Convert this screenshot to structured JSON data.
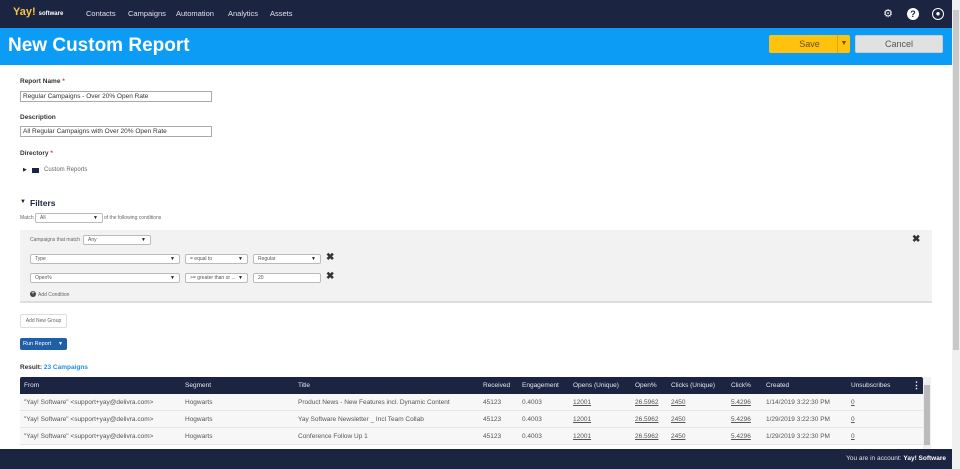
{
  "nav": {
    "logo": "Yay!",
    "logo_sub": "software",
    "items": [
      "Contacts",
      "Campaigns",
      "Automation",
      "Analytics",
      "Assets"
    ]
  },
  "header": {
    "title": "New Custom Report",
    "save": "Save",
    "cancel": "Cancel"
  },
  "form": {
    "report_name_label": "Report Name",
    "report_name": "Regular Campaigns - Over 20% Open Rate",
    "description_label": "Description",
    "description": "All Regular Campaigns with Over 20% Open Rate",
    "directory_label": "Directory",
    "directory": "Custom Reports",
    "required": "*"
  },
  "filters": {
    "title": "Filters",
    "match_label": "Match",
    "match_value": "All",
    "match_suffix": "of the following conditions",
    "group_label": "Campaigns that match",
    "group_value": "Any",
    "conditions": [
      {
        "field": "Type",
        "op": "= equal to",
        "value": "Regular"
      },
      {
        "field": "Open%",
        "op": ">= greater than or ...",
        "value": "20"
      }
    ],
    "add_condition": "Add Condition",
    "add_group": "Add New Group",
    "run": "Run Report"
  },
  "result": {
    "label": "Result:",
    "count": "23 Campaigns"
  },
  "table": {
    "columns": [
      "From",
      "Segment",
      "Title",
      "Received",
      "Engagement",
      "Opens (Unique)",
      "Open%",
      "Clicks (Unique)",
      "Click%",
      "Created",
      "Unsubscribes"
    ],
    "rows": [
      [
        "\"Yay! Software\" <support+yay@delivra.com>",
        "Hogwarts",
        "Product News - New Features incl. Dynamic Content",
        "45123",
        "0.4003",
        "12001",
        "26.5962",
        "2450",
        "5.4296",
        "1/14/2019 3:22:30 PM",
        "0"
      ],
      [
        "\"Yay! Software\" <support+yay@delivra.com>",
        "Hogwarts",
        "Yay Software Newsletter _ Incl Team Collab",
        "45123",
        "0.4003",
        "12001",
        "26.5962",
        "2450",
        "5.4296",
        "1/29/2019 3:22:30 PM",
        "0"
      ],
      [
        "\"Yay! Software\" <support+yay@delivra.com>",
        "Hogwarts",
        "Conference Follow Up 1",
        "45123",
        "0.4003",
        "12001",
        "26.5962",
        "2450",
        "5.4296",
        "1/29/2019 3:22:30 PM",
        "0"
      ]
    ]
  },
  "footer": {
    "prefix": "You are in account:",
    "account": "Yay! Software"
  }
}
